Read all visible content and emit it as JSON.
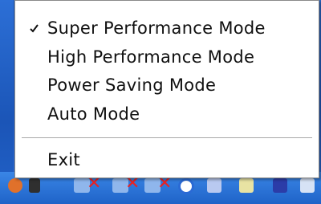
{
  "menu": {
    "items": [
      {
        "label": "Super Performance Mode",
        "checked": true
      },
      {
        "label": "High Performance Mode",
        "checked": false
      },
      {
        "label": "Power Saving Mode",
        "checked": false
      },
      {
        "label": "Auto Mode",
        "checked": false
      }
    ],
    "exit_label": "Exit",
    "check_icon": "checkmark-icon"
  },
  "tray": {
    "icons": [
      "app-icon",
      "speaker-icon",
      "network-disconnected-icon",
      "network-disconnected-icon",
      "network-disconnected-icon",
      "security-icon",
      "tray-app-icon",
      "tray-app-icon",
      "tray-app-icon",
      "tray-app-icon"
    ]
  },
  "colors": {
    "menu_background": "#ffffff",
    "menu_text": "#101010",
    "desktop_blue": "#1d56b8",
    "status_error_red": "#e82323"
  }
}
